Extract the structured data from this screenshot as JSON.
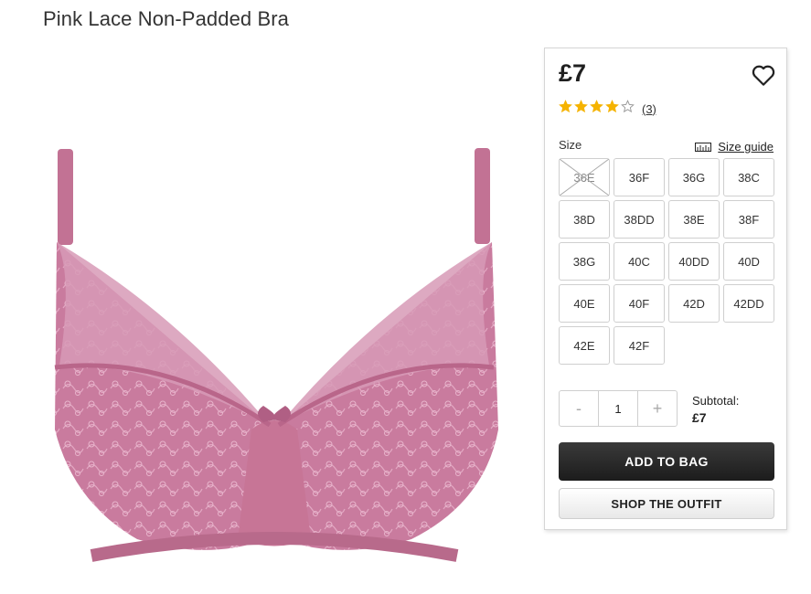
{
  "product": {
    "title": "Pink Lace Non-Padded Bra"
  },
  "price": "£7",
  "rating": {
    "stars": 4,
    "max": 5,
    "count_label": "(3)"
  },
  "size_label": "Size",
  "size_guide_label": "Size guide",
  "sizes": [
    {
      "label": "36E",
      "available": false
    },
    {
      "label": "36F",
      "available": true
    },
    {
      "label": "36G",
      "available": true
    },
    {
      "label": "38C",
      "available": true
    },
    {
      "label": "38D",
      "available": true
    },
    {
      "label": "38DD",
      "available": true
    },
    {
      "label": "38E",
      "available": true
    },
    {
      "label": "38F",
      "available": true
    },
    {
      "label": "38G",
      "available": true
    },
    {
      "label": "40C",
      "available": true
    },
    {
      "label": "40DD",
      "available": true
    },
    {
      "label": "40D",
      "available": true
    },
    {
      "label": "40E",
      "available": true
    },
    {
      "label": "40F",
      "available": true
    },
    {
      "label": "42D",
      "available": true
    },
    {
      "label": "42DD",
      "available": true
    },
    {
      "label": "42E",
      "available": true
    },
    {
      "label": "42F",
      "available": true
    }
  ],
  "quantity": {
    "minus": "-",
    "value": "1",
    "plus": "+"
  },
  "subtotal": {
    "label": "Subtotal:",
    "value": "£7"
  },
  "add_to_bag_label": "ADD TO BAG",
  "shop_outfit_label": "SHOP THE OUTFIT",
  "colors": {
    "star": "#f5b301",
    "product_pink": "#c8799a"
  },
  "icons": {
    "wishlist": "heart-icon",
    "size_guide": "ruler-icon"
  }
}
